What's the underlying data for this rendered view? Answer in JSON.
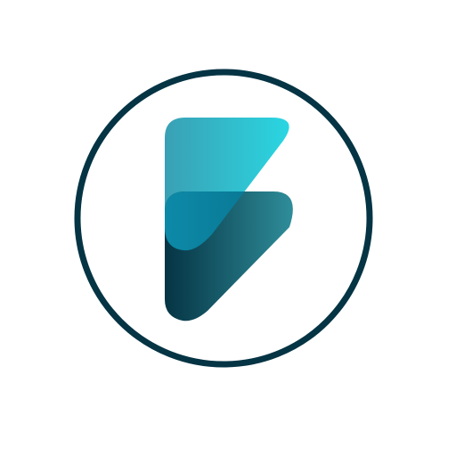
{
  "logo": {
    "icon": "stylized-letter-f-mark",
    "ring_color": "#053444",
    "background_color": "#ffffff",
    "colors": {
      "top_shape_start": "#3aa0b4",
      "top_shape_end": "#2ad6e2",
      "bottom_shape_start": "#053444",
      "bottom_shape_end": "#2f8d9a",
      "overlap_start": "#0d8aa8",
      "overlap_end": "#06708c"
    }
  }
}
